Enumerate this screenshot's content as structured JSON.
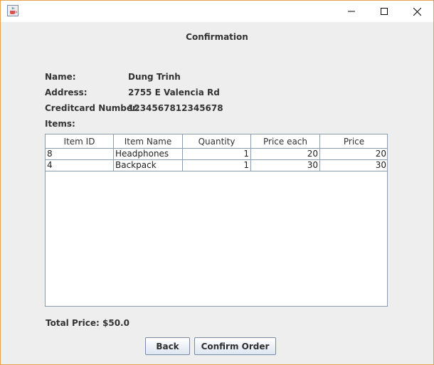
{
  "window": {
    "icon": "java-cup-icon",
    "controls": [
      "minimize-icon",
      "maximize-icon",
      "close-icon"
    ]
  },
  "dialog": {
    "title": "Confirmation",
    "name_label": "Name:",
    "name_value": "Dung Trinh",
    "address_label": "Address:",
    "address_value": "2755 E Valencia Rd",
    "card_label": "Creditcard Number:",
    "card_value": "1234567812345678",
    "items_label": "Items:"
  },
  "table": {
    "columns": [
      "Item ID",
      "Item Name",
      "Quantity",
      "Price each",
      "Price"
    ],
    "rows": [
      [
        "8",
        "Headphones",
        "1",
        "20",
        "20"
      ],
      [
        "4",
        "Backpack",
        "1",
        "30",
        "30"
      ]
    ]
  },
  "total": {
    "label": "Total Price:",
    "value": "$50.0"
  },
  "buttons": {
    "back": "Back",
    "confirm": "Confirm Order"
  }
}
